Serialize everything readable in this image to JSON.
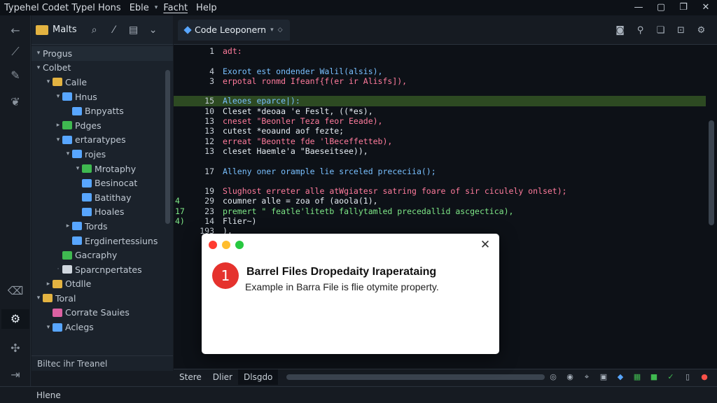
{
  "app": {
    "menu": [
      "Typehel Codet Typel Hons",
      "Eble",
      "Facht",
      "Help"
    ],
    "window_controls": [
      "minimize",
      "restore",
      "maximize",
      "close"
    ]
  },
  "activity_bar": [
    {
      "icon": "back-arrow-icon"
    },
    {
      "icon": "pin-icon"
    },
    {
      "icon": "pen-icon"
    },
    {
      "icon": "feather-icon"
    },
    {
      "icon": "trash-icon"
    },
    {
      "icon": "debug-icon",
      "selected": true
    },
    {
      "icon": "extensions-icon"
    },
    {
      "icon": "exit-icon"
    }
  ],
  "sidebar": {
    "title": "Malts",
    "footer": "Biltec ihr Treanel",
    "tree": [
      {
        "label": "Progus",
        "depth": 0,
        "arrow": "▾",
        "color": ""
      },
      {
        "label": "Colbet",
        "depth": 0,
        "arrow": "▾",
        "color": ""
      },
      {
        "label": "Calle",
        "depth": 1,
        "arrow": "▾",
        "color": "#e3b341"
      },
      {
        "label": "Hnus",
        "depth": 2,
        "arrow": "▾",
        "color": "#58a6ff"
      },
      {
        "label": "Bnpyatts",
        "depth": 3,
        "arrow": "",
        "color": "#58a6ff"
      },
      {
        "label": "Pdges",
        "depth": 2,
        "arrow": "▸",
        "color": "#3fb950"
      },
      {
        "label": "ertaratypes",
        "depth": 2,
        "arrow": "▾",
        "color": "#58a6ff"
      },
      {
        "label": "rojes",
        "depth": 3,
        "arrow": "▾",
        "color": "#58a6ff"
      },
      {
        "label": "Mrotaphy",
        "depth": 4,
        "arrow": "▾",
        "color": "#3fb950"
      },
      {
        "label": "Besinocat",
        "depth": 4,
        "arrow": "",
        "color": "#58a6ff"
      },
      {
        "label": "Batithay",
        "depth": 4,
        "arrow": "",
        "color": "#58a6ff"
      },
      {
        "label": "Hoales",
        "depth": 4,
        "arrow": "",
        "color": "#58a6ff"
      },
      {
        "label": "Tords",
        "depth": 3,
        "arrow": "▸",
        "color": "#58a6ff"
      },
      {
        "label": "Ergdinertessiuns",
        "depth": 3,
        "arrow": "",
        "color": "#58a6ff"
      },
      {
        "label": "Gacraphy",
        "depth": 2,
        "arrow": "",
        "color": "#3fb950"
      },
      {
        "label": "Sparcnpertates",
        "depth": 2,
        "arrow": "·",
        "color": "#d0d7de"
      },
      {
        "label": "Otdlle",
        "depth": 1,
        "arrow": "▸",
        "color": "#e3b341"
      },
      {
        "label": "Toral",
        "depth": 0,
        "arrow": "▾",
        "color": "#e3b341"
      },
      {
        "label": "Corrate Sauies",
        "depth": 1,
        "arrow": "",
        "color": "#db61a2"
      },
      {
        "label": "Aclegs",
        "depth": 1,
        "arrow": "▾",
        "color": "#58a6ff"
      }
    ]
  },
  "editor": {
    "tab_label": "Code Leoponern",
    "tab_caret": "▾",
    "toolbar": [
      "camera-icon",
      "person-icon",
      "copy-icon",
      "export-icon",
      "settings-icon"
    ],
    "lines": [
      {
        "num": "1",
        "text": "adt:",
        "color": "#ff7b9c",
        "hl": false,
        "gutter": ""
      },
      {
        "num": "",
        "text": "",
        "color": "#e6edf3",
        "hl": false,
        "gutter": ""
      },
      {
        "num": "4",
        "text": "Exorot est ondender Walil(alsis),",
        "color": "#79c0ff",
        "hl": false,
        "gutter": ""
      },
      {
        "num": "3",
        "text": "erpotal ronmd Ifeanf{f(er ir Alisfs]),",
        "color": "#ff7b9c",
        "hl": false,
        "gutter": ""
      },
      {
        "num": "",
        "text": "",
        "color": "#e6edf3",
        "hl": false,
        "gutter": ""
      },
      {
        "num": "15",
        "text": "Aleoes eparce|):",
        "color": "#79c0ff",
        "hl": true,
        "gutter": ""
      },
      {
        "num": "10",
        "text": "Cleset *deoaa 'e Feslt, ((*es),",
        "color": "#e6edf3",
        "hl": false,
        "gutter": ""
      },
      {
        "num": "13",
        "text": "cneset \"Beonler Teza feor Eeade),",
        "color": "#ff7b9c",
        "hl": false,
        "gutter": ""
      },
      {
        "num": "13",
        "text": "cutest *eoaund aof fezte;",
        "color": "#e6edf3",
        "hl": false,
        "gutter": ""
      },
      {
        "num": "12",
        "text": "erreat \"Beontte fde 'lBeceffetteb),",
        "color": "#ff7b9c",
        "hl": false,
        "gutter": ""
      },
      {
        "num": "13",
        "text": "cleset  Haemle'a \"Baeseitsee)),",
        "color": "#e6edf3",
        "hl": false,
        "gutter": ""
      },
      {
        "num": "",
        "text": "",
        "color": "#e6edf3",
        "hl": false,
        "gutter": ""
      },
      {
        "num": "17",
        "text": "Alleny oner orample lie srceled prececiia();",
        "color": "#79c0ff",
        "hl": false,
        "gutter": ""
      },
      {
        "num": "",
        "text": "",
        "color": "#e6edf3",
        "hl": false,
        "gutter": ""
      },
      {
        "num": "19",
        "text": "Slughost erreter alle atWgiatesr satring foare of sir ciculely onlset);",
        "color": "#ff7b9c",
        "hl": false,
        "gutter": ""
      },
      {
        "num": "29",
        "text": "  coumner alle = zoa of (aoola(1),",
        "color": "#e6edf3",
        "hl": false,
        "gutter": "4"
      },
      {
        "num": "23",
        "text": "  premert \" featle'litetb fallytamled precedallid ascgectica),",
        "color": "#7ee787",
        "hl": false,
        "gutter": "17"
      },
      {
        "num": "14",
        "text": "  Flier~)",
        "color": "#e6edf3",
        "hl": false,
        "gutter": "4)"
      },
      {
        "num": "193",
        "text": "),",
        "color": "#e6edf3",
        "hl": false,
        "gutter": ""
      }
    ]
  },
  "panel": {
    "tabs": [
      "Stere",
      "Dlier",
      "Dlsgdo"
    ],
    "icons": [
      "ring-icon",
      "ring-icon",
      "pin-icon",
      "chip-icon",
      "shield-icon",
      "grid-icon",
      "square-icon",
      "check-icon",
      "book-icon",
      "mic-icon"
    ]
  },
  "status": {
    "text": "Hlene"
  },
  "dialog": {
    "number": "1",
    "title": "Barrel Files Dropedaity Iraperataing",
    "message": "Example in Barra File is flie otymite property.",
    "close": "✕"
  }
}
